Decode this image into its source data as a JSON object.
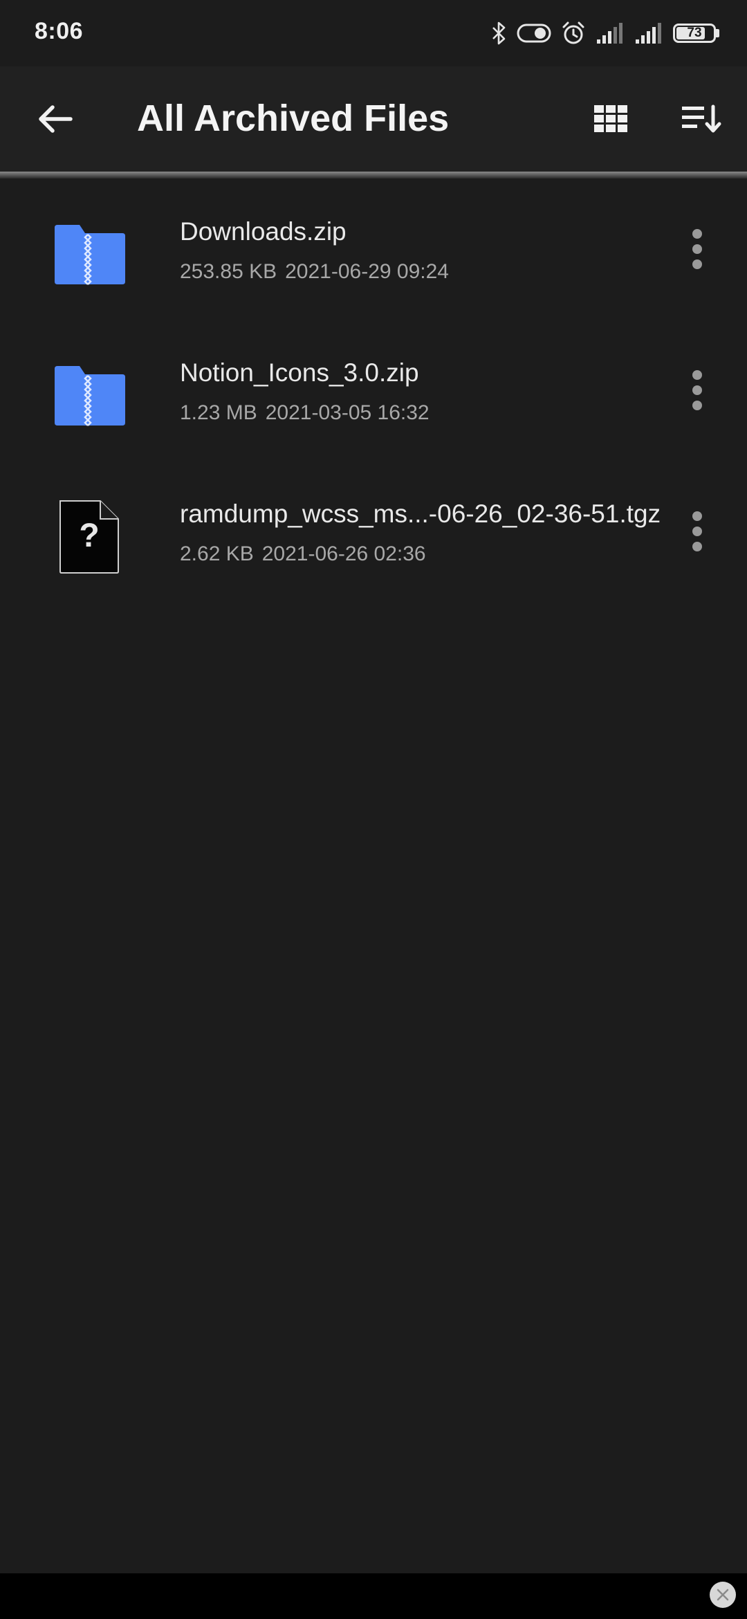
{
  "status_bar": {
    "time": "8:06",
    "battery_level": "73",
    "icons": [
      "bluetooth-icon",
      "toggle-icon",
      "alarm-icon",
      "signal-icon",
      "signal-icon",
      "battery-icon"
    ]
  },
  "app_bar": {
    "title": "All Archived Files",
    "back_icon": "arrow-left-icon",
    "view_icon": "grid-view-icon",
    "sort_icon": "sort-icon"
  },
  "files": [
    {
      "name": "Downloads.zip",
      "size": "253.85 KB",
      "date": "2021-06-29 09:24",
      "icon": "zip-folder-icon"
    },
    {
      "name": "Notion_Icons_3.0.zip",
      "size": "1.23 MB",
      "date": "2021-03-05 16:32",
      "icon": "zip-folder-icon"
    },
    {
      "name": "ramdump_wcss_ms...-06-26_02-36-51.tgz",
      "size": "2.62 KB",
      "date": "2021-06-26 02:36",
      "icon": "unknown-file-icon"
    }
  ],
  "colors": {
    "background": "#1c1c1c",
    "app_bar": "#212121",
    "folder_blue": "#4f86f7",
    "text_primary": "#e9e9e9",
    "text_secondary": "#a8a8a8"
  }
}
